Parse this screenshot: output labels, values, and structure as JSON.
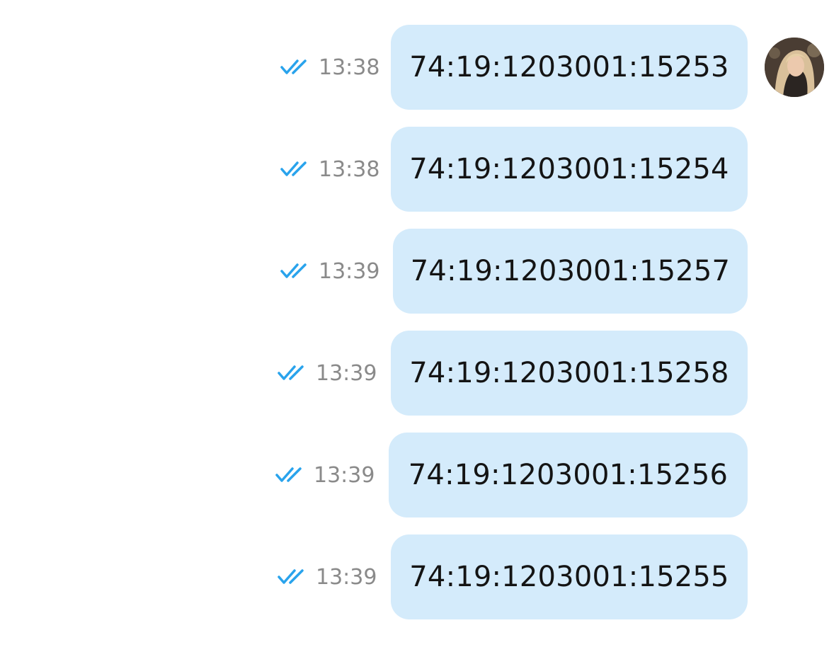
{
  "colors": {
    "bubble": "#d4ebfb",
    "read_check": "#29a3ec",
    "time_text": "#8a8a8a",
    "message_text": "#141414"
  },
  "messages": [
    {
      "text": "74:19:1203001:15253",
      "time": "13:38",
      "status_icon": "double-check-icon"
    },
    {
      "text": "74:19:1203001:15254",
      "time": "13:38",
      "status_icon": "double-check-icon"
    },
    {
      "text": "74:19:1203001:15257",
      "time": "13:39",
      "status_icon": "double-check-icon"
    },
    {
      "text": "74:19:1203001:15258",
      "time": "13:39",
      "status_icon": "double-check-icon"
    },
    {
      "text": "74:19:1203001:15256",
      "time": "13:39",
      "status_icon": "double-check-icon"
    },
    {
      "text": "74:19:1203001:15255",
      "time": "13:39",
      "status_icon": "double-check-icon"
    }
  ],
  "avatar": {
    "icon": "user-avatar"
  }
}
